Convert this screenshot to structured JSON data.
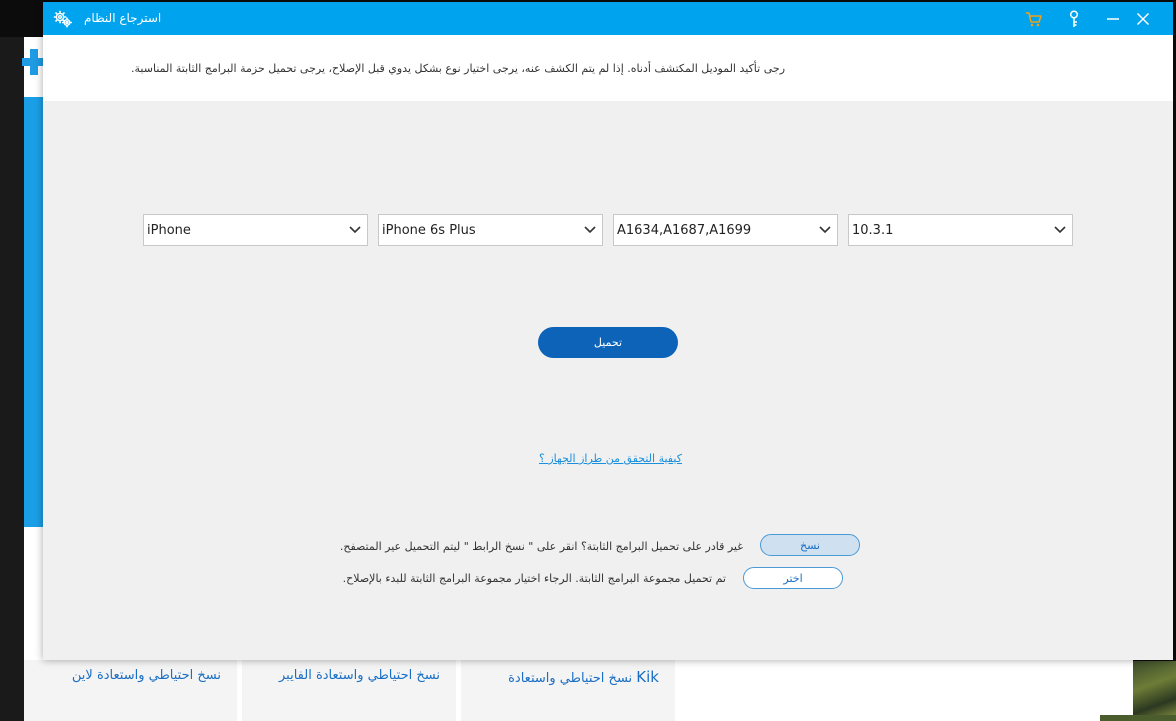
{
  "window": {
    "title": "استرجاع النظام",
    "notice": "رجى تأكيد الموديل المكتشف أدناه. إذا لم يتم الكشف عنه، يرجى اختيار نوع بشكل يدوي قبل الإصلاح، يرجى تحميل حزمة البرامج الثابتة المناسبة."
  },
  "selects": {
    "device_type": "iPhone",
    "device_model": "iPhone 6s Plus",
    "model_number": "A1634,A1687,A1699",
    "ios_version": "10.3.1"
  },
  "actions": {
    "download_label": "تحميل",
    "help_link": "كيفية التحقق من طراز الجهاز ؟",
    "copy_label": "نسخ",
    "choose_label": "اختر"
  },
  "messages": {
    "cannot_download": "غير قادر على تحميل البرامج الثابتة؟ انقر على \" نسخ الرابط \" ليتم التحميل عير المتصفح.",
    "downloaded": "تم تحميل مجموعة البرامج الثابتة. الرجاء اختيار مجموعة البرامج الثابتة للبدء بالإصلاح."
  },
  "background": {
    "cards": [
      {
        "label": "نسخ احتياطي واستعادة لاين"
      },
      {
        "label": "نسخ احتياطي واستعادة الفايبر"
      },
      {
        "label_ar": "نسخ احتياطي واستعادة",
        "label_en": "Kik"
      }
    ]
  },
  "colors": {
    "titlebar": "#00a3ee",
    "primary_button": "#0d63b8",
    "link": "#1a8fdc",
    "cart_icon": "#f0a11b"
  },
  "icons": {
    "title": "gear-cluster-icon",
    "cart": "cart-icon",
    "key": "key-icon",
    "minimize": "minimize-icon",
    "close": "close-icon",
    "dropdown": "chevron-down-icon"
  }
}
